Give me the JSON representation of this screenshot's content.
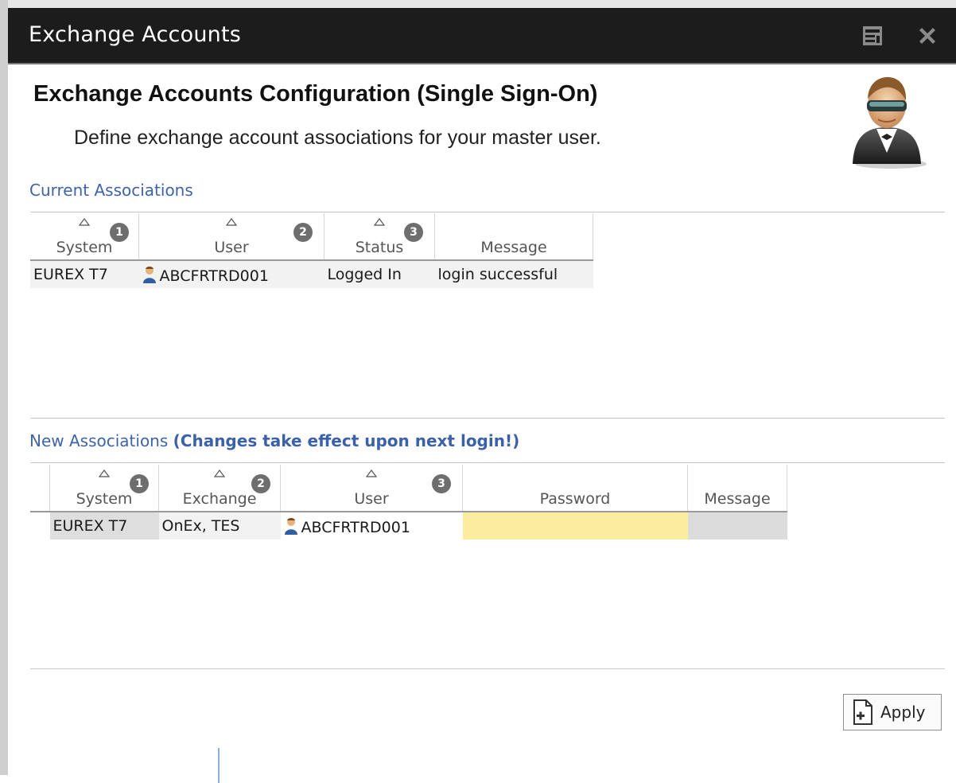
{
  "window": {
    "title": "Exchange Accounts",
    "minimize_icon": "panel-icon",
    "close_icon": "close-icon"
  },
  "header": {
    "heading": "Exchange Accounts Configuration (Single Sign-On)",
    "subheading": "Define exchange account associations for your master user.",
    "figure_icon": "user-figure-icon"
  },
  "current": {
    "label": "Current Associations",
    "columns": [
      {
        "label": "System",
        "sort_badge": "1"
      },
      {
        "label": "User",
        "sort_badge": "2"
      },
      {
        "label": "Status",
        "sort_badge": "3"
      },
      {
        "label": "Message",
        "sort_badge": ""
      }
    ],
    "rows": [
      {
        "system": "EUREX T7",
        "user": "ABCFRTRD001",
        "status": "Logged In",
        "message": "login successful"
      }
    ]
  },
  "new": {
    "label": "New Associations",
    "note": "(Changes take effect upon next login!)",
    "columns": [
      {
        "label": "System",
        "sort_badge": "1"
      },
      {
        "label": "Exchange",
        "sort_badge": "2"
      },
      {
        "label": "User",
        "sort_badge": "3"
      },
      {
        "label": "Password",
        "sort_badge": ""
      },
      {
        "label": "Message",
        "sort_badge": ""
      }
    ],
    "rows": [
      {
        "system": "EUREX T7",
        "exchange": "OnEx, TES",
        "user": "ABCFRTRD001",
        "password": "",
        "message": ""
      }
    ]
  },
  "actions": {
    "apply_label": "Apply",
    "apply_icon": "add-document-icon"
  },
  "colors": {
    "title_bar": "#1c1c1c",
    "section_link": "#3e64a8",
    "password_field": "#fcec9f",
    "badge": "#6e6e6e"
  }
}
